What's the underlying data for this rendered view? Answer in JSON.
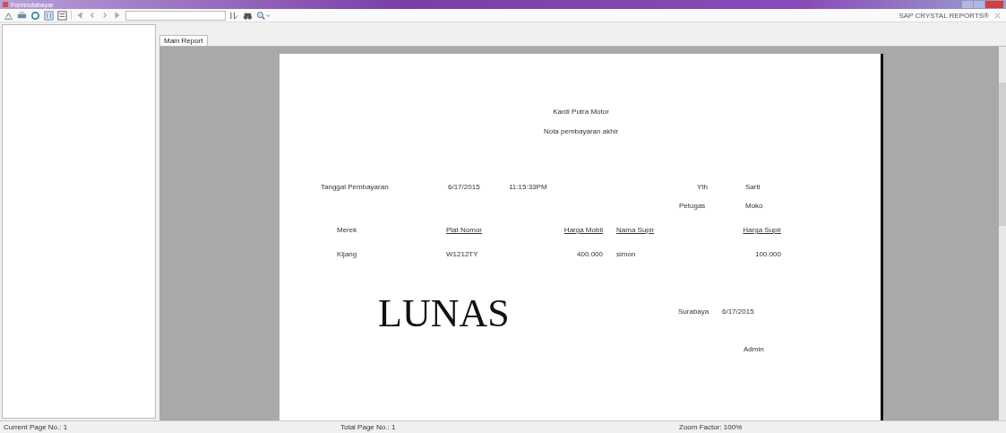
{
  "window": {
    "title": "Formnotabayar"
  },
  "toolbar": {
    "brand": "SAP CRYSTAL REPORTS®"
  },
  "tabs": [
    {
      "label": "Main Report",
      "selected": true
    }
  ],
  "report": {
    "company": "Kardi Putra Motor",
    "subtitle": "Nota pembayaran akhir",
    "payment_label": "Tanggal Pembayaran",
    "payment_date": "6/17/2015",
    "payment_time": "11:15:33PM",
    "to_label": "Yth",
    "to_name": "Sarti",
    "officer_label": "Petugas",
    "officer_name": "Moko",
    "columns": [
      "Merek",
      "Plat Nomor",
      "Harga Mobil",
      "Nama Supir",
      "Harga Supir"
    ],
    "rows": [
      [
        "Kijang",
        "W1212TY",
        "400.000",
        "simon",
        "100.000"
      ]
    ],
    "stamp": "LUNAS",
    "city": "Surabaya",
    "sign_date": "6/17/2015",
    "signer": "Admin"
  },
  "status_bar": [
    "Current Page No.: 1",
    "Total Page No.: 1",
    "Zoom Factor: 100%"
  ]
}
